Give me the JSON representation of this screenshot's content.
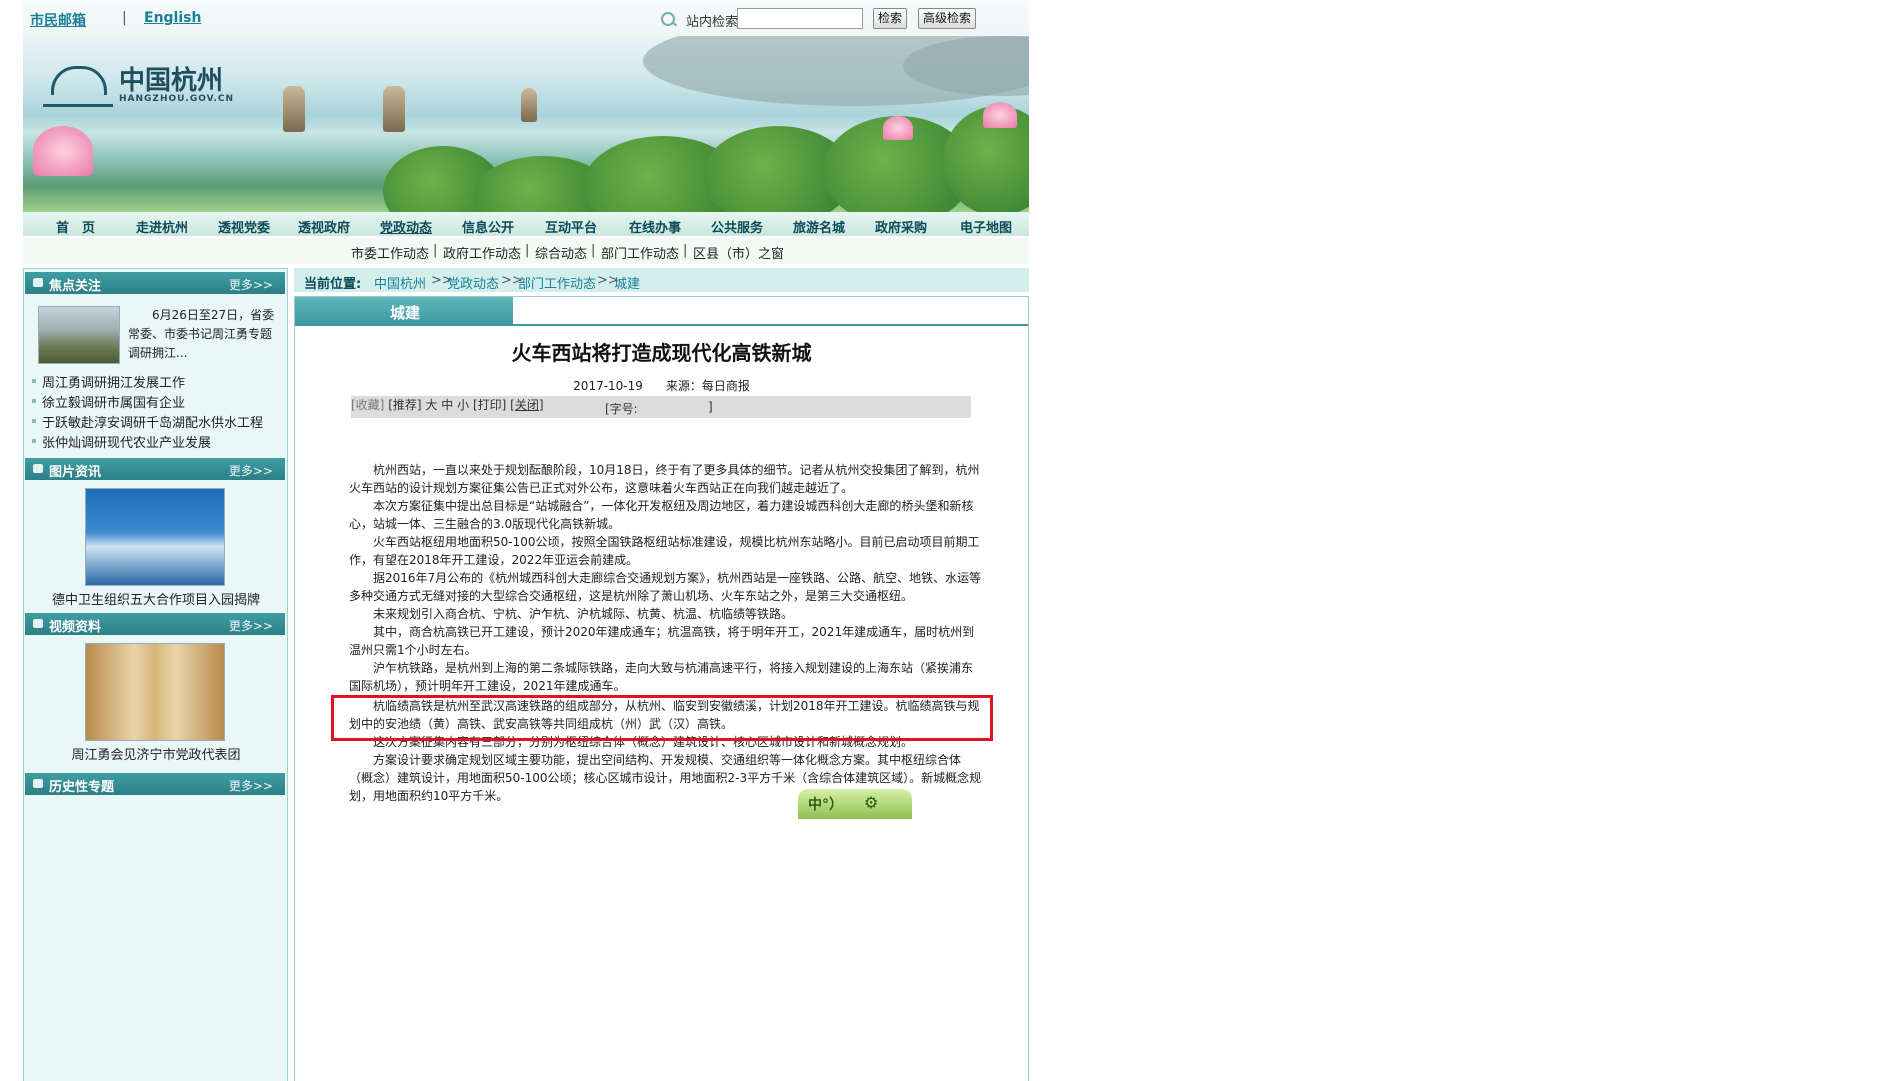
{
  "topbar": {
    "mailbox_link": "市民邮箱",
    "separator": "|",
    "english_link": "English",
    "search_label": "站内检索",
    "search_value": "",
    "search_button": "检索",
    "advanced_search_button": "高级检索"
  },
  "banner": {
    "logo_text": "中国杭州",
    "logo_sub": "HANGZHOU.GOV.CN"
  },
  "nav": {
    "items": [
      "首　页",
      "走进杭州",
      "透视党委",
      "透视政府",
      "党政动态",
      "信息公开",
      "互动平台",
      "在线办事",
      "公共服务",
      "旅游名城",
      "政府采购",
      "电子地图"
    ],
    "active_index": 4
  },
  "subnav": {
    "items": [
      "市委工作动态",
      "政府工作动态",
      "综合动态",
      "部门工作动态",
      "区县（市）之窗"
    ],
    "separator": "|"
  },
  "left": {
    "focus": {
      "title": "焦点关注",
      "more": "更多>>",
      "lead_text": "6月26日至27日，省委常委、市委书记周江勇专题调研拥江...",
      "items": [
        "周江勇调研拥江发展工作",
        "徐立毅调研市属国有企业",
        "于跃敏赴淳安调研千岛湖配水供水工程",
        "张仲灿调研现代农业产业发展"
      ]
    },
    "photo": {
      "title": "图片资讯",
      "more": "更多>>",
      "caption": "德中卫生组织五大合作项目入园揭牌"
    },
    "video": {
      "title": "视频资料",
      "more": "更多>>",
      "caption": "周江勇会见济宁市党政代表团"
    },
    "history": {
      "title": "历史性专题",
      "more": "更多>>"
    }
  },
  "breadcrumb": {
    "label": "当前位置:",
    "items": [
      "中国杭州",
      "党政动态",
      "部门工作动态",
      "城建"
    ],
    "sep": ">>"
  },
  "article": {
    "category": "城建",
    "title": "火车西站将打造成现代化高铁新城",
    "date": "2017-10-19",
    "source": "来源：每日商报",
    "toolbar": {
      "favorite": "[收藏]",
      "recommend": "[推荐]",
      "font_label": "[字号:",
      "font_large": "大",
      "font_medium": "中",
      "font_small": "小",
      "font_close": "]",
      "print": "[打印]",
      "close": "[关闭]"
    },
    "paragraphs": [
      "杭州西站，一直以来处于规划酝酿阶段，10月18日，终于有了更多具体的细节。记者从杭州交投集团了解到，杭州火车西站的设计规划方案征集公告已正式对外公布，这意味着火车西站正在向我们越走越近了。",
      "本次方案征集中提出总目标是“站城融合”，一体化开发枢纽及周边地区，着力建设城西科创大走廊的桥头堡和新核心，站城一体、三生融合的3.0版现代化高铁新城。",
      "火车西站枢纽用地面积50-100公顷，按照全国铁路枢纽站标准建设，规模比杭州东站略小。目前已启动项目前期工作，有望在2018年开工建设，2022年亚运会前建成。",
      "据2016年7月公布的《杭州城西科创大走廊综合交通规划方案》，杭州西站是一座铁路、公路、航空、地铁、水运等多种交通方式无缝对接的大型综合交通枢纽，这是杭州除了萧山机场、火车东站之外，是第三大交通枢纽。",
      "未来规划引入商合杭、宁杭、沪乍杭、沪杭城际、杭黄、杭温、杭临绩等铁路。",
      "其中，商合杭高铁已开工建设，预计2020年建成通车；杭温高铁，将于明年开工，2021年建成通车，届时杭州到温州只需1个小时左右。",
      "沪乍杭铁路，是杭州到上海的第二条城际铁路，走向大致与杭浦高速平行，将接入规划建设的上海东站（紧挨浦东国际机场），预计明年开工建设，2021年建成通车。",
      "杭临绩高铁是杭州至武汉高速铁路的组成部分，从杭州、临安到安徽绩溪，计划2018年开工建设。杭临绩高铁与规划中的安池绩（黄）高铁、武安高铁等共同组成杭（州）武（汉）高铁。",
      "这次方案征集内容有三部分，分别为枢纽综合体（概念）建筑设计、核心区城市设计和新城概念规划。",
      "方案设计要求确定规划区域主要功能，提出空间结构、开发规模、交通组织等一体化概念方案。其中枢纽综合体（概念）建筑设计，用地面积50-100公顷；核心区城市设计，用地面积2-3平方千米（含综合体建筑区域）。新城概念规划，用地面积约10平方千米。"
    ]
  },
  "float_widget": {
    "label": "中°）"
  },
  "colors": {
    "highlight_border": "#e0141e",
    "nav_text": "#0d4a5a",
    "panel_head": "#2c7f86",
    "breadcrumb_link": "#1b7f98"
  }
}
